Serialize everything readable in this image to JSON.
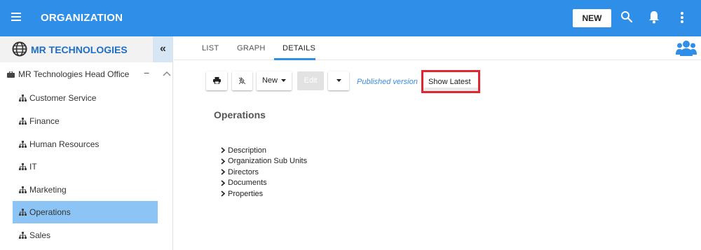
{
  "header": {
    "title": "ORGANIZATION",
    "new_label": "NEW",
    "icons": [
      "menu-icon",
      "search-icon",
      "bell-icon",
      "more-vert-icon"
    ]
  },
  "sidebar": {
    "org_name": "MR TECHNOLOGIES",
    "collapse_label": "«",
    "root": {
      "label": "MR Technologies Head Office",
      "toggle": "−"
    },
    "items": [
      {
        "label": "Customer Service"
      },
      {
        "label": "Finance"
      },
      {
        "label": "Human Resources"
      },
      {
        "label": "IT"
      },
      {
        "label": "Marketing"
      },
      {
        "label": "Operations",
        "selected": true
      },
      {
        "label": "Sales"
      }
    ]
  },
  "main": {
    "tabs": [
      {
        "label": "LIST"
      },
      {
        "label": "GRAPH"
      },
      {
        "label": "DETAILS",
        "active": true
      }
    ],
    "toolbar": {
      "new_label": "New",
      "edit_label": "Edit",
      "published_label": "Published version",
      "show_latest_label": "Show Latest"
    },
    "title": "Operations",
    "details": [
      {
        "label": "Description"
      },
      {
        "label": "Organization Sub Units"
      },
      {
        "label": "Directors"
      },
      {
        "label": "Documents"
      },
      {
        "label": "Properties"
      }
    ]
  },
  "colors": {
    "primary": "#2f8fe8",
    "selected": "#8cc5f5",
    "org_name": "#1e6fc4",
    "highlight_border": "#e0262f"
  }
}
